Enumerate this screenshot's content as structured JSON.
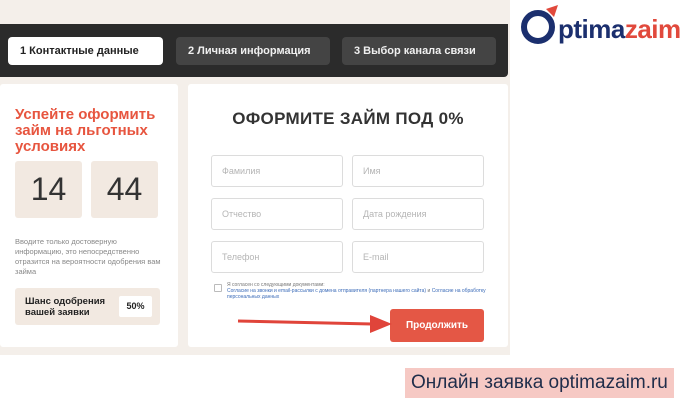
{
  "steps": [
    {
      "label": "1 Контактные данные"
    },
    {
      "label": "2 Личная информация"
    },
    {
      "label": "3 Выбор канала связи"
    }
  ],
  "logo": {
    "text_dark": "ptima",
    "text_red": "zaim",
    "colors": {
      "dark": "#1b2f6e",
      "red": "#e1493c"
    }
  },
  "promo": {
    "title": "Успейте оформить займ на льготных условиях",
    "timer": {
      "hours": "14",
      "minutes": "44"
    },
    "hint": "Вводите только достоверную информацию, это непосредственно отразится на вероятности одобрения вам займа",
    "chance_label": "Шанс одобрения вашей заявки",
    "chance_value": "50%"
  },
  "form": {
    "title": "ОФОРМИТЕ ЗАЙМ ПОД 0%",
    "fields": {
      "last_name": {
        "placeholder": "Фамилия",
        "value": ""
      },
      "first_name": {
        "placeholder": "Имя",
        "value": ""
      },
      "middle_name": {
        "placeholder": "Отчество",
        "value": ""
      },
      "birth_date": {
        "placeholder": "Дата рождения",
        "value": ""
      },
      "phone": {
        "placeholder": "Телефон",
        "value": ""
      },
      "email": {
        "placeholder": "E-mail",
        "value": ""
      }
    },
    "consent": {
      "line1": "Я согласен со следующими документами:",
      "line2_link1": "Согласие на звонки и email-рассылки с домена отправителя (партнера нашего сайта)",
      "line2_and": " и ",
      "line2_link2": "Согласие на обработку персональных данных",
      "checked": false
    },
    "submit_label": "Продолжить"
  },
  "caption": "Онлайн заявка optimazaim.ru",
  "colors": {
    "accent": "#e45745",
    "dark_bar": "#2b2b2b",
    "page_bg": "#f4efea",
    "caption_bg": "#f6c9c4"
  }
}
